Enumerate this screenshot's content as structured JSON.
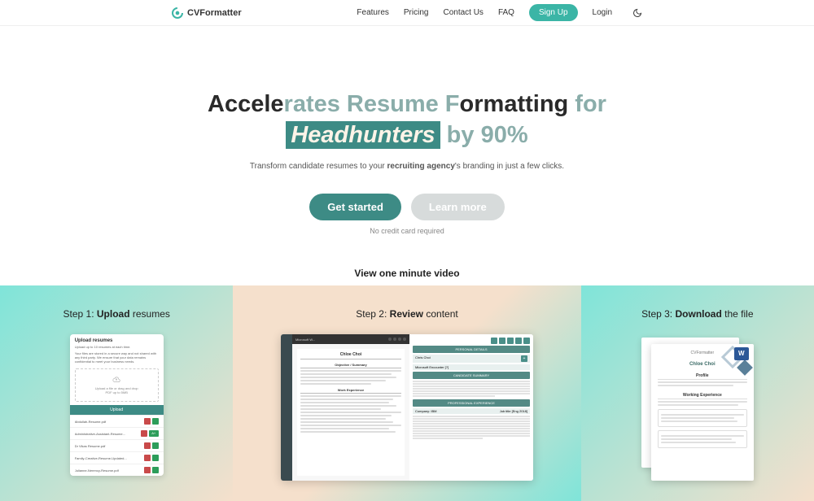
{
  "header": {
    "logo_text_bold": "CV",
    "logo_text_rest": "Formatter",
    "nav": {
      "features": "Features",
      "pricing": "Pricing",
      "contact": "Contact Us",
      "faq": "FAQ",
      "signup": "Sign Up",
      "login": "Login"
    }
  },
  "hero": {
    "title_l1_a": "Accele",
    "title_l1_b": "rates Resume F",
    "title_l1_c": "ormatting",
    "title_l1_d": " for",
    "title_l2_hl": "Headhunters",
    "title_l2_b": " by 90%",
    "subtitle_a": "Transform candidate resumes to your ",
    "subtitle_b": "recruiting agency",
    "subtitle_c": "'s branding in just a few clicks.",
    "cta_primary": "Get started",
    "cta_secondary": "Learn more",
    "nocard": "No credit card required",
    "video_title": "View one minute video"
  },
  "steps": {
    "s1_a": "Step 1: ",
    "s1_b": "Upload",
    "s1_c": " resumes",
    "s2_a": "Step 2: ",
    "s2_b": "Review",
    "s2_c": " content",
    "s3_a": "Step 3: ",
    "s3_b": "Download",
    "s3_c": " the file"
  },
  "upload": {
    "title": "Upload resumes",
    "desc": "Upload up to 10 resumes at each time.",
    "desc2": "Your files are stored in a secure way and not shared with any third party. We ensure that your data remains confidential to meet your business needs.",
    "drop": "Upload a file or drag and drop",
    "drop2": "PDF up to 5MB",
    "btn": "Upload",
    "files": [
      "Abdullah-Resume.pdf",
      "Administrative-Assistant-Resume...",
      "Dr Vikas Resume.pdf",
      "Family-Creative-Resume-Updated...",
      "Julianne-Nerency-Resume.pdf"
    ],
    "badge_aplus": "A+"
  },
  "editor": {
    "tab": "Microsoft W...",
    "doc_name": "Chloe Choi",
    "sec1": "Objective / Summary",
    "sec2": "Work Experience",
    "r_sec1": "PERSONAL DETAILS",
    "r_sec2": "CANDIDATE SUMMARY",
    "r_sec3": "PROFESSIONAL EXPERIENCE",
    "r_sub1": "Chris Choi",
    "r_sub2": "Microsoft Encounter [?]",
    "r_sub3": "Company: IBM",
    "r_sub4": "Job title [Eng 2018]"
  },
  "download": {
    "word": "W",
    "logo": "CVFormatter",
    "name": "Chloe Choi",
    "sec1": "Profile",
    "sec2": "Working Experience"
  }
}
